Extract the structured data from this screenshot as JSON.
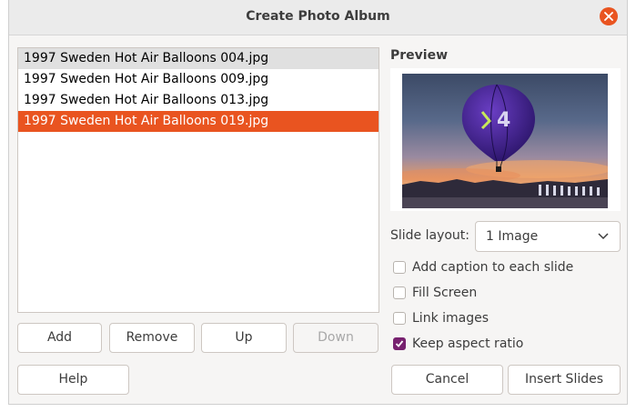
{
  "window": {
    "title": "Create Photo Album"
  },
  "files": [
    {
      "name": "1997 Sweden Hot Air Balloons 004.jpg",
      "state": "hover"
    },
    {
      "name": "1997 Sweden Hot Air Balloons 009.jpg",
      "state": "normal"
    },
    {
      "name": "1997 Sweden Hot Air Balloons 013.jpg",
      "state": "normal"
    },
    {
      "name": "1997 Sweden Hot Air Balloons 019.jpg",
      "state": "selected"
    }
  ],
  "list_buttons": {
    "add": "Add",
    "remove": "Remove",
    "up": "Up",
    "down": "Down"
  },
  "preview": {
    "label": "Preview"
  },
  "layout": {
    "label": "Slide layout:",
    "selected": "1 Image"
  },
  "options": {
    "caption": {
      "label": "Add caption to each slide",
      "checked": false
    },
    "fill": {
      "label": "Fill Screen",
      "checked": false
    },
    "link": {
      "label": "Link images",
      "checked": false
    },
    "aspect": {
      "label": "Keep aspect ratio",
      "checked": true
    }
  },
  "footer": {
    "help": "Help",
    "cancel": "Cancel",
    "insert": "Insert Slides"
  },
  "colors": {
    "accent": "#e95420",
    "checkbox": "#77216f"
  }
}
